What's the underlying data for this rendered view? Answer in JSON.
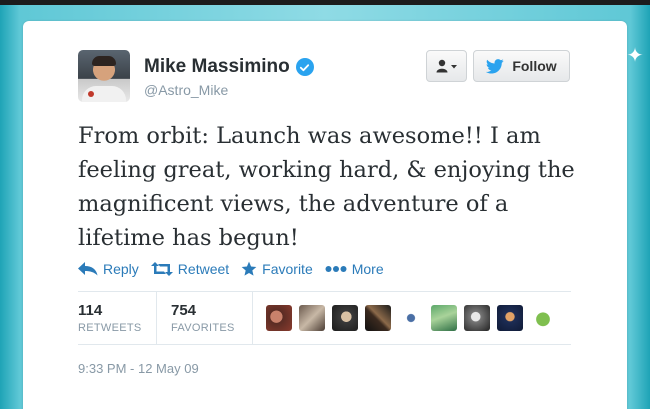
{
  "user": {
    "name": "Mike Massimino",
    "handle": "@Astro_Mike",
    "verified": true
  },
  "buttons": {
    "user_menu_icon": "user-dropdown-icon",
    "follow_label": "Follow"
  },
  "tweet": {
    "text": "From orbit: Launch was awesome!! I am feeling great, working hard, & enjoying the magnificent views, the adventure of a lifetime has begun!"
  },
  "actions": [
    {
      "label": "Reply",
      "icon": "reply-icon"
    },
    {
      "label": "Retweet",
      "icon": "retweet-icon"
    },
    {
      "label": "Favorite",
      "icon": "star-icon"
    },
    {
      "label": "More",
      "icon": "more-dots-icon"
    }
  ],
  "stats": {
    "retweets": {
      "count": "114",
      "label": "RETWEETS"
    },
    "favorites": {
      "count": "754",
      "label": "FAVORITES"
    }
  },
  "timestamp": "9:33 PM - 12 May 09",
  "colors": {
    "link": "#2b7bb9",
    "verified": "#2aa3ef",
    "twitter_bird": "#2aa3ef",
    "background": "#8fdbe5"
  }
}
